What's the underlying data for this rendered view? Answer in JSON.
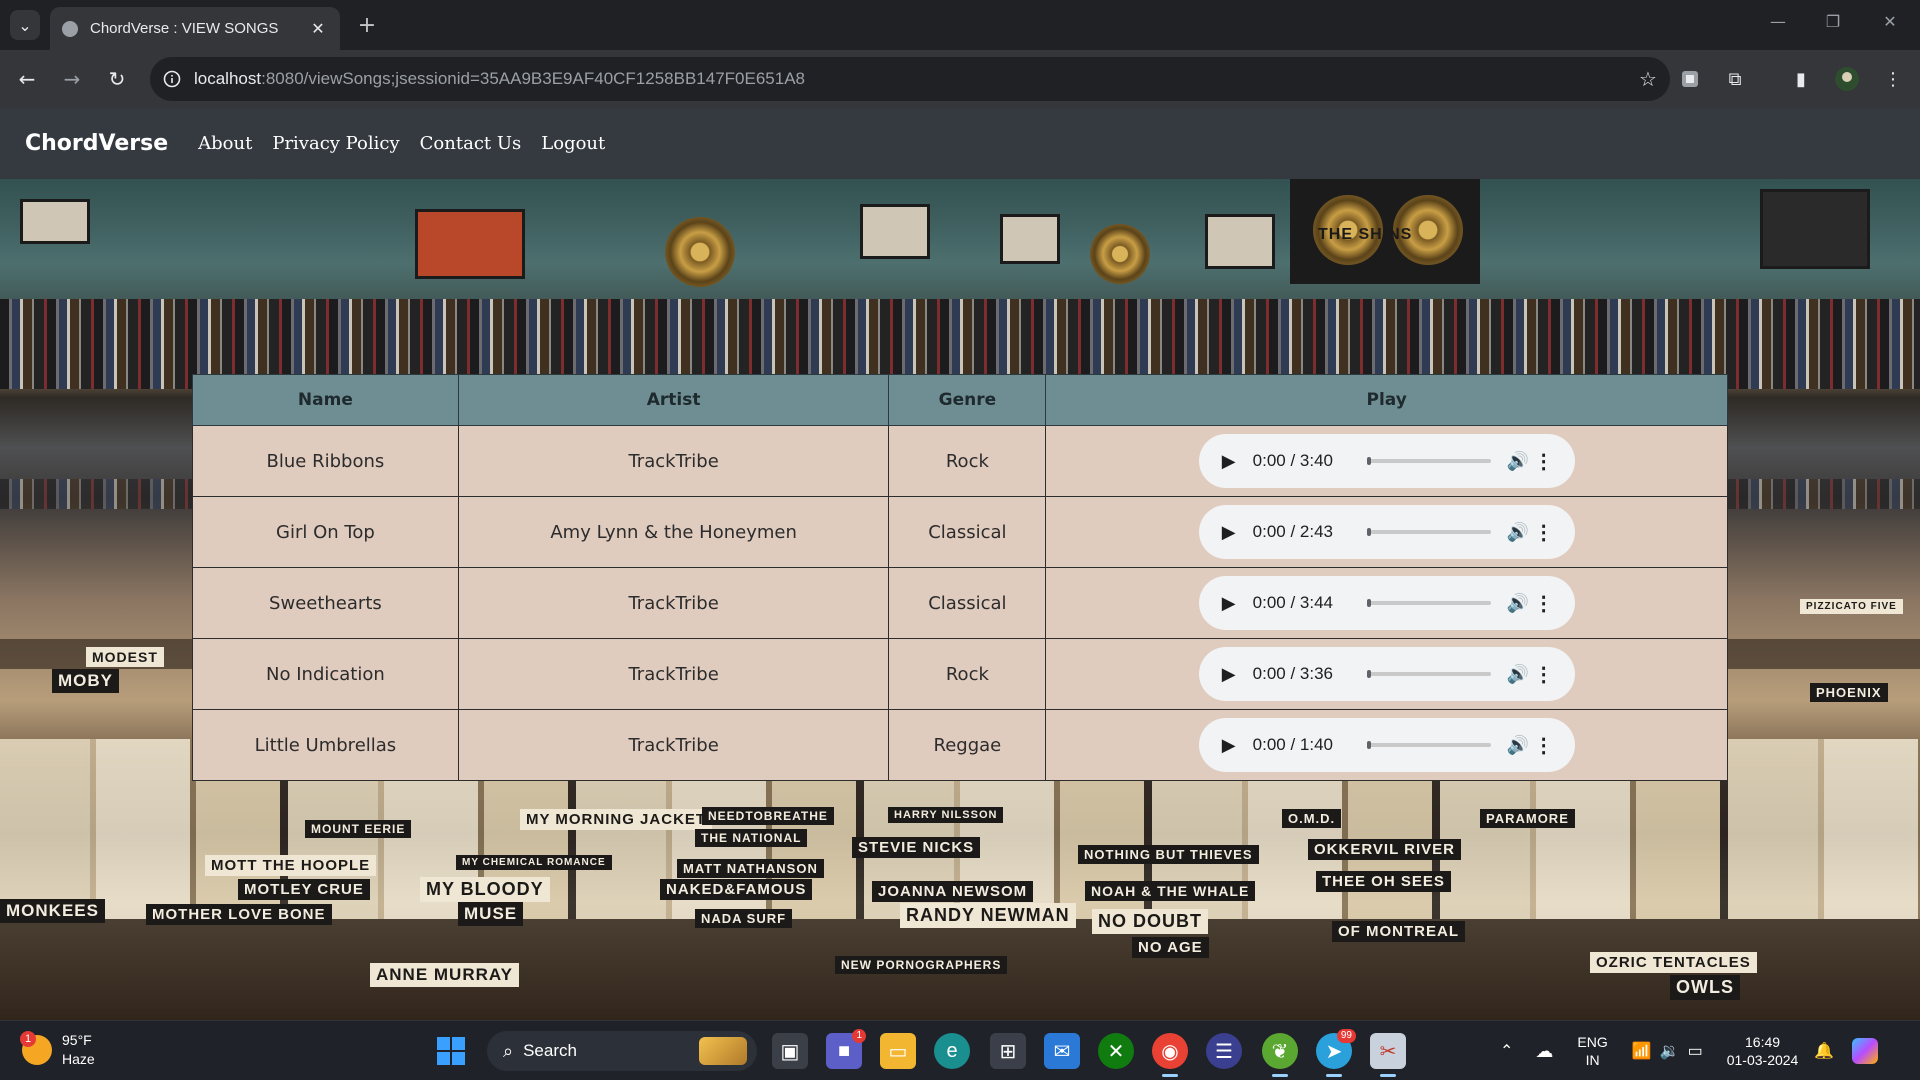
{
  "browser": {
    "tab_title": "ChordVerse : VIEW SONGS",
    "tab_close": "✕",
    "new_tab": "+",
    "url_host": "localhost",
    "url_rest": ":8080/viewSongs;jsessionid=35AA9B3E9AF40CF1258BB147F0E651A8"
  },
  "navbar": {
    "brand": "ChordVerse",
    "links": [
      "About",
      "Privacy Policy",
      "Contact Us",
      "Logout"
    ]
  },
  "table": {
    "headers": [
      "Name",
      "Artist",
      "Genre",
      "Play"
    ],
    "rows": [
      {
        "name": "Blue Ribbons",
        "artist": "TrackTribe",
        "genre": "Rock",
        "time": "0:00 / 3:40"
      },
      {
        "name": "Girl On Top",
        "artist": "Amy Lynn & the Honeymen",
        "genre": "Classical",
        "time": "0:00 / 2:43"
      },
      {
        "name": "Sweethearts",
        "artist": "TrackTribe",
        "genre": "Classical",
        "time": "0:00 / 3:44"
      },
      {
        "name": "No Indication",
        "artist": "TrackTribe",
        "genre": "Rock",
        "time": "0:00 / 3:36"
      },
      {
        "name": "Little Umbrellas",
        "artist": "TrackTribe",
        "genre": "Reggae",
        "time": "0:00 / 1:40"
      }
    ]
  },
  "background_cards": [
    "MY MORNING JACKET",
    "NEEDTOBREATHE",
    "THE NATIONAL",
    "MATT NATHANSON",
    "NAKED&FAMOUS",
    "NADA SURF",
    "STEVIE NICKS",
    "JOANNA NEWSOM",
    "RANDY NEWMAN",
    "NEW PORNOGRAPHERS",
    "NOTHING BUT THIEVES",
    "NOAH & THE WHALE",
    "NO DOUBT",
    "NO AGE",
    "OKKERVIL RIVER",
    "THEE OH SEES",
    "OF MONTREAL",
    "OZRIC TENTACLES",
    "OWLS",
    "MOTT THE HOOPLE",
    "MOTLEY CRUE",
    "MY BLOODY",
    "MUSE",
    "MOTHER LOVE BONE",
    "ANNE MURRAY",
    "MONKEES",
    "MOBY",
    "MODEST",
    "PHOENIX",
    "PIZZICATO FIVE",
    "O.M.D.",
    "PARAMORE",
    "MOUNT EERIE",
    "MY CHEMICAL ROMANCE",
    "HARRY NILSSON",
    "THE SHINS"
  ],
  "taskbar": {
    "weather_temp": "95°F",
    "weather_desc": "Haze",
    "weather_badge": "1",
    "search_label": "Search",
    "lang_top": "ENG",
    "lang_bottom": "IN",
    "time": "16:49",
    "date": "01-03-2024",
    "teams_badge": "1",
    "telegram_badge": "99"
  },
  "colors": {
    "navbar_bg": "#343a40",
    "table_header_bg": "#6f8e94",
    "table_cell_bg": "#e0cbbf",
    "audio_bg": "#f1f3f4"
  }
}
